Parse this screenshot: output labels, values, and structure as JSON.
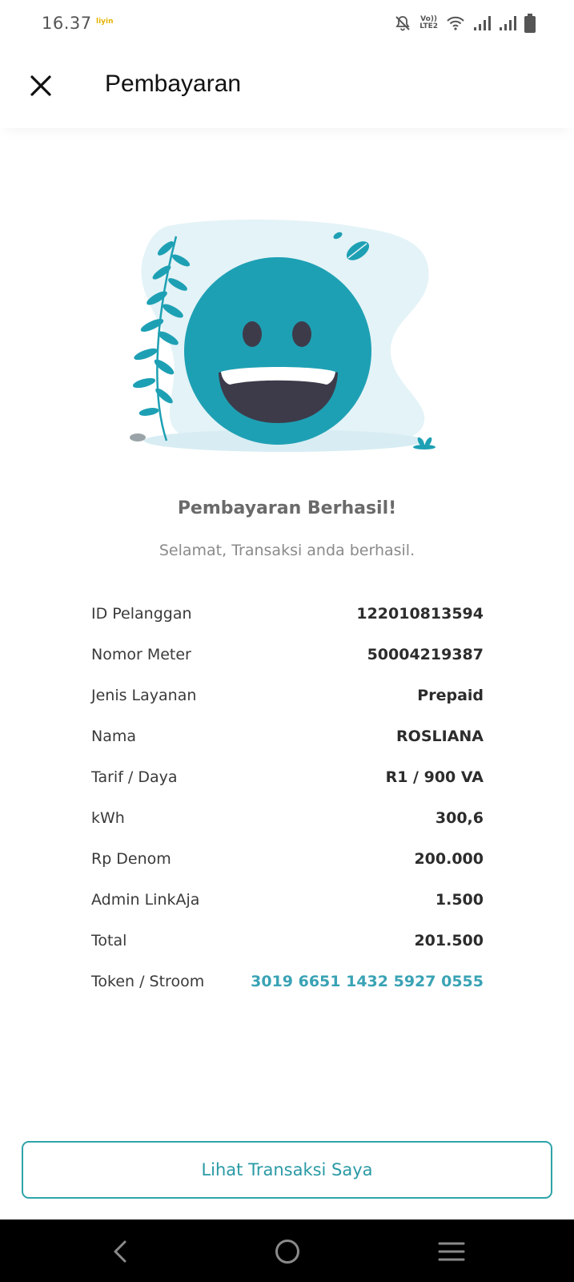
{
  "status_bar": {
    "time": "16.37",
    "app_notification": "liyin",
    "volte_top": "Vo))",
    "volte_bottom": "LTE2"
  },
  "header": {
    "title": "Pembayaran",
    "close_icon": "close-icon"
  },
  "result": {
    "title": "Pembayaran Berhasil!",
    "subtitle": "Selamat, Transaksi anda berhasil."
  },
  "details": [
    {
      "label": "ID Pelanggan",
      "value": "122010813594"
    },
    {
      "label": "Nomor Meter",
      "value": "50004219387"
    },
    {
      "label": "Jenis Layanan",
      "value": "Prepaid"
    },
    {
      "label": "Nama",
      "value": "ROSLIANA"
    },
    {
      "label": "Tarif / Daya",
      "value": "R1 / 900 VA"
    },
    {
      "label": "kWh",
      "value": "300,6"
    },
    {
      "label": "Rp Denom",
      "value": "200.000"
    },
    {
      "label": "Admin LinkAja",
      "value": "1.500"
    },
    {
      "label": "Total",
      "value": "201.500"
    },
    {
      "label": "Token / Stroom",
      "value": "3019 6651 1432 5927 0555"
    }
  ],
  "actions": {
    "view_transactions_label": "Lihat Transaksi Saya"
  },
  "colors": {
    "accent": "#2fa3a9",
    "token_text": "#3aa3b5",
    "smiley": "#1ea0b4",
    "blob": "#e4f3f7"
  },
  "nav": {
    "back_icon": "back-icon",
    "home_icon": "home-icon",
    "menu_icon": "menu-icon"
  }
}
